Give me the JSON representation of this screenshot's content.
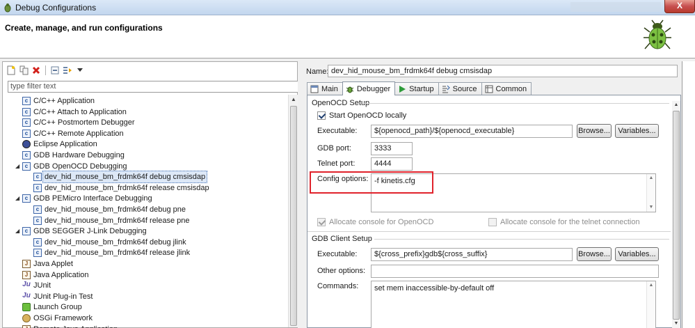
{
  "window": {
    "title": "Debug Configurations",
    "close_glyph": "X"
  },
  "banner": {
    "heading": "Create, manage, and run configurations"
  },
  "toolbar": {
    "icons": [
      "new-config-icon",
      "duplicate-icon",
      "delete-icon",
      "collapse-all-icon",
      "filter-icon",
      "dropdown-arrow-icon"
    ]
  },
  "filter": {
    "placeholder": "type filter text"
  },
  "tree": {
    "items": [
      {
        "label": "C/C++ Application",
        "icon": "c-app-icon",
        "level": 1
      },
      {
        "label": "C/C++ Attach to Application",
        "icon": "c-app-icon",
        "level": 1
      },
      {
        "label": "C/C++ Postmortem Debugger",
        "icon": "c-app-icon",
        "level": 1
      },
      {
        "label": "C/C++ Remote Application",
        "icon": "c-app-icon",
        "level": 1
      },
      {
        "label": "Eclipse Application",
        "icon": "eclipse-icon",
        "level": 1
      },
      {
        "label": "GDB Hardware Debugging",
        "icon": "c-app-icon",
        "level": 1
      },
      {
        "label": "GDB OpenOCD Debugging",
        "icon": "c-app-icon",
        "level": 1,
        "expanded": true
      },
      {
        "label": "dev_hid_mouse_bm_frdmk64f debug cmsisdap",
        "icon": "c-app-icon",
        "level": 2,
        "selected": true
      },
      {
        "label": "dev_hid_mouse_bm_frdmk64f release cmsisdap",
        "icon": "c-app-icon",
        "level": 2
      },
      {
        "label": "GDB PEMicro Interface Debugging",
        "icon": "c-app-icon",
        "level": 1,
        "expanded": true
      },
      {
        "label": "dev_hid_mouse_bm_frdmk64f debug pne",
        "icon": "c-app-icon",
        "level": 2
      },
      {
        "label": "dev_hid_mouse_bm_frdmk64f release pne",
        "icon": "c-app-icon",
        "level": 2
      },
      {
        "label": "GDB SEGGER J-Link Debugging",
        "icon": "c-app-icon",
        "level": 1,
        "expanded": true
      },
      {
        "label": "dev_hid_mouse_bm_frdmk64f debug jlink",
        "icon": "c-app-icon",
        "level": 2
      },
      {
        "label": "dev_hid_mouse_bm_frdmk64f release jlink",
        "icon": "c-app-icon",
        "level": 2
      },
      {
        "label": "Java Applet",
        "icon": "java-icon",
        "level": 1
      },
      {
        "label": "Java Application",
        "icon": "java-icon",
        "level": 1
      },
      {
        "label": "JUnit",
        "icon": "junit-icon",
        "level": 1
      },
      {
        "label": "JUnit Plug-in Test",
        "icon": "junit-icon",
        "level": 1
      },
      {
        "label": "Launch Group",
        "icon": "launch-group-icon",
        "level": 1
      },
      {
        "label": "OSGi Framework",
        "icon": "osgi-icon",
        "level": 1
      },
      {
        "label": "Remote Java Application",
        "icon": "java-icon",
        "level": 1
      }
    ]
  },
  "config": {
    "name_label": "Name:",
    "name_value": "dev_hid_mouse_bm_frdmk64f debug cmsisdap",
    "tabs": [
      {
        "label": "Main",
        "icon": "main-tab-icon"
      },
      {
        "label": "Debugger",
        "icon": "debugger-tab-icon",
        "active": true
      },
      {
        "label": "Startup",
        "icon": "startup-tab-icon"
      },
      {
        "label": "Source",
        "icon": "source-tab-icon"
      },
      {
        "label": "Common",
        "icon": "common-tab-icon"
      }
    ]
  },
  "openocd": {
    "group_title": "OpenOCD Setup",
    "start_locally_label": "Start OpenOCD locally",
    "start_locally_checked": true,
    "executable_label": "Executable:",
    "executable_value": "${openocd_path}/${openocd_executable}",
    "browse_label": "Browse...",
    "variables_label": "Variables...",
    "gdb_port_label": "GDB port:",
    "gdb_port_value": "3333",
    "telnet_port_label": "Telnet port:",
    "telnet_port_value": "4444",
    "config_options_label": "Config options:",
    "config_options_value": "-f kinetis.cfg",
    "allocate_console_label": "Allocate console for OpenOCD",
    "allocate_console_checked": true,
    "allocate_telnet_label": "Allocate console for the telnet connection",
    "allocate_telnet_checked": false
  },
  "gdbclient": {
    "group_title": "GDB Client Setup",
    "executable_label": "Executable:",
    "executable_value": "${cross_prefix}gdb${cross_suffix}",
    "browse_label": "Browse...",
    "variables_label": "Variables...",
    "other_options_label": "Other options:",
    "other_options_value": "",
    "commands_label": "Commands:",
    "commands_value": "set mem inaccessible-by-default off"
  },
  "colors": {
    "highlight": "#e0222b",
    "selection": "#dde8f7"
  }
}
